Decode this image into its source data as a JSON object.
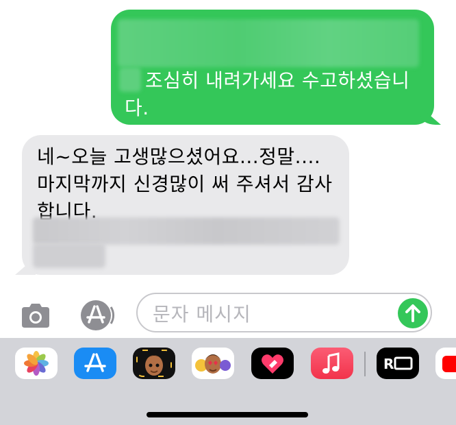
{
  "conversation": {
    "sent_message": "조심히 내려가세요 수고하셨습니다.",
    "received_message": "네~오늘 고생많으셨어요...정말....마지막까지 신경많이 써 주셔서 감사합니다."
  },
  "input": {
    "placeholder": "문자 메시지"
  },
  "app_drawer": {
    "apps": [
      "photos-app",
      "app-store-app",
      "memoji-app",
      "memoji-stickers-app",
      "digital-touch-app",
      "music-app",
      "r-app",
      "youtube-app"
    ]
  },
  "colors": {
    "sent_bubble": "#34c759",
    "received_bubble": "#e9e9eb",
    "drawer_bg": "#d3d4d9",
    "icon_gray": "#8e8e93"
  }
}
